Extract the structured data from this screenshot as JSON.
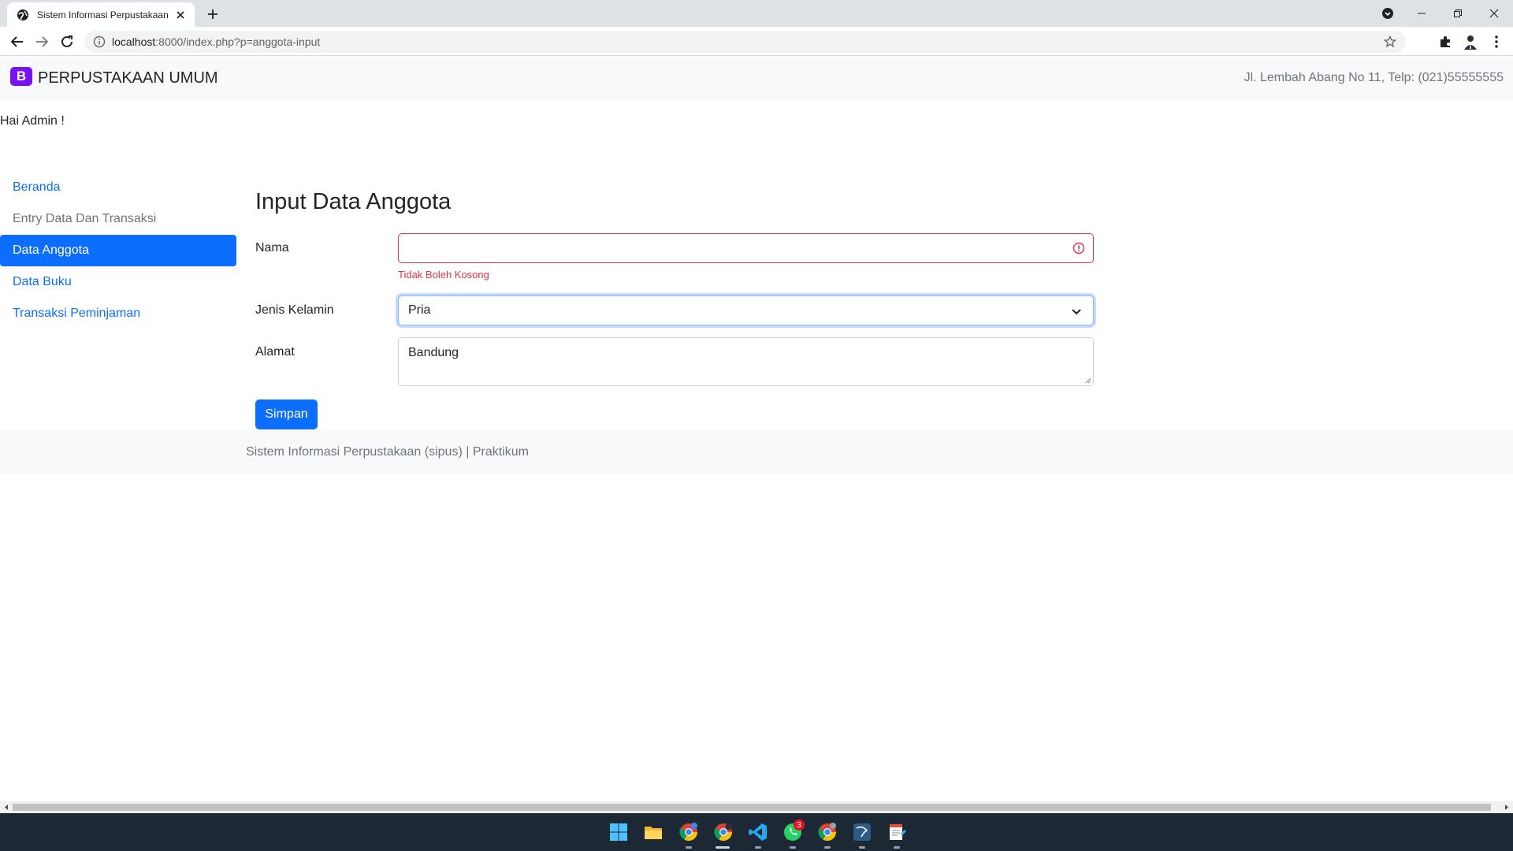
{
  "browser": {
    "tab_title": "Sistem Informasi Perpustakaan",
    "url_host": "localhost",
    "url_path": ":8000/index.php?p=anggota-input"
  },
  "navbar": {
    "brand_logo": "B",
    "brand_name": "PERPUSTAKAAN UMUM",
    "address": "Jl. Lembah Abang No 11, Telp: (021)55555555"
  },
  "greeting": "Hai Admin !",
  "sidebar": {
    "items": [
      {
        "label": "Beranda"
      },
      {
        "label": "Entry Data Dan Transaksi"
      },
      {
        "label": "Data Anggota"
      },
      {
        "label": "Data Buku"
      },
      {
        "label": "Transaksi Peminjaman"
      }
    ]
  },
  "form": {
    "title": "Input Data Anggota",
    "nama_label": "Nama",
    "nama_value": "",
    "nama_error": "Tidak Boleh Kosong",
    "jk_label": "Jenis Kelamin",
    "jk_value": "Pria",
    "alamat_label": "Alamat",
    "alamat_value": "Bandung",
    "submit_label": "Simpan"
  },
  "footer": {
    "text": "Sistem Informasi Perpustakaan (sipus) | Praktikum"
  },
  "taskbar": {
    "whatsapp_badge": "3"
  },
  "colors": {
    "primary": "#0d6efd",
    "danger": "#dc3545",
    "brand": "#7a11f4",
    "taskbar": "#1c2834"
  }
}
